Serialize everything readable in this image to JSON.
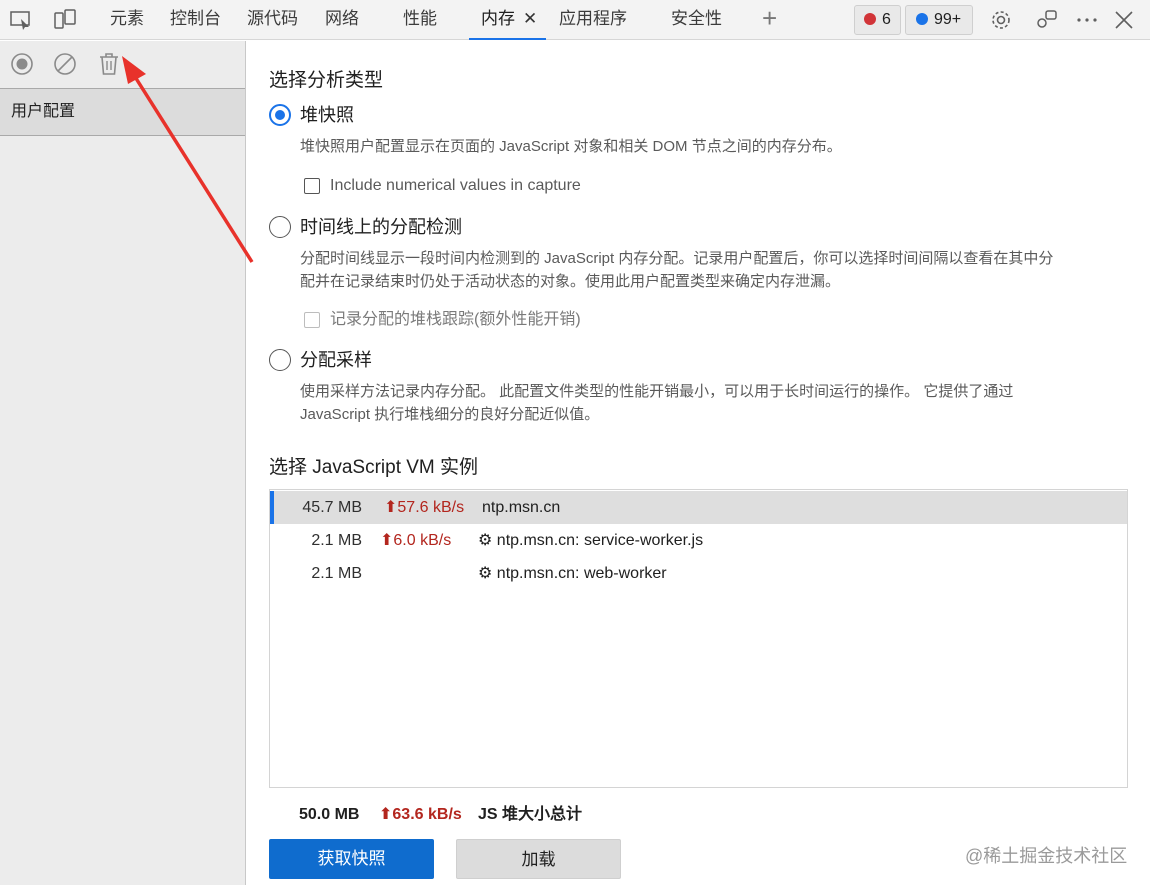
{
  "toolbar": {
    "icons": [
      "inspect-icon",
      "device-emulation-icon"
    ],
    "tabs": [
      {
        "label": "元素"
      },
      {
        "label": "控制台"
      },
      {
        "label": "源代码"
      },
      {
        "label": "网络"
      },
      {
        "label": "性能"
      },
      {
        "label": "内存",
        "active": true,
        "close": "✕"
      },
      {
        "label": "应用程序"
      },
      {
        "label": "安全性"
      }
    ],
    "add_tab": "+",
    "errors_count": "6",
    "messages_count": "99+",
    "colors": {
      "error": "#d13438",
      "message": "#1a73e8",
      "accent": "#1a73e8"
    }
  },
  "sidebar": {
    "tool_icons": [
      "record-icon",
      "clear-icon",
      "delete-icon"
    ],
    "item_label": "用户配置"
  },
  "main": {
    "section1_title": "选择分析类型",
    "options": [
      {
        "label": "堆快照",
        "checked": true,
        "description": "堆快照用户配置显示在页面的 JavaScript 对象和相关 DOM 节点之间的内存分布。",
        "checkbox": {
          "label": "Include numerical values in capture",
          "checked": false,
          "disabled": false
        }
      },
      {
        "label": "时间线上的分配检测",
        "checked": false,
        "description_line1": "分配时间线显示一段时间内检测到的 JavaScript 内存分配。记录用户配置后，你可以选择时间间隔以查看在其中分",
        "description_line2": "配并在记录结束时仍处于活动状态的对象。使用此用户配置类型来确定内存泄漏。",
        "checkbox": {
          "label": "记录分配的堆栈跟踪(额外性能开销)",
          "checked": false,
          "disabled": true
        }
      },
      {
        "label": "分配采样",
        "checked": false,
        "description_line1": "使用采样方法记录内存分配。 此配置文件类型的性能开销最小，可以用于长时间运行的操作。 它提供了通过",
        "description_line2": "JavaScript 执行堆栈细分的良好分配近似值。"
      }
    ],
    "section2_title": "选择 JavaScript VM 实例",
    "vm_rows": [
      {
        "size": "45.7 MB",
        "rate": "⬆57.6 kB/s",
        "name": "ntp.msn.cn",
        "selected": true
      },
      {
        "size": "2.1 MB",
        "rate": "⬆6.0 kB/s",
        "name": "⚙ ntp.msn.cn: service-worker.js"
      },
      {
        "size": "2.1 MB",
        "rate": "",
        "name": "⚙ ntp.msn.cn: web-worker"
      }
    ],
    "total_size": "50.0 MB",
    "total_rate": "⬆63.6 kB/s",
    "total_label": "JS 堆大小总计",
    "primary_button": "获取快照",
    "secondary_button": "加载"
  },
  "watermark": "@稀土掘金技术社区"
}
